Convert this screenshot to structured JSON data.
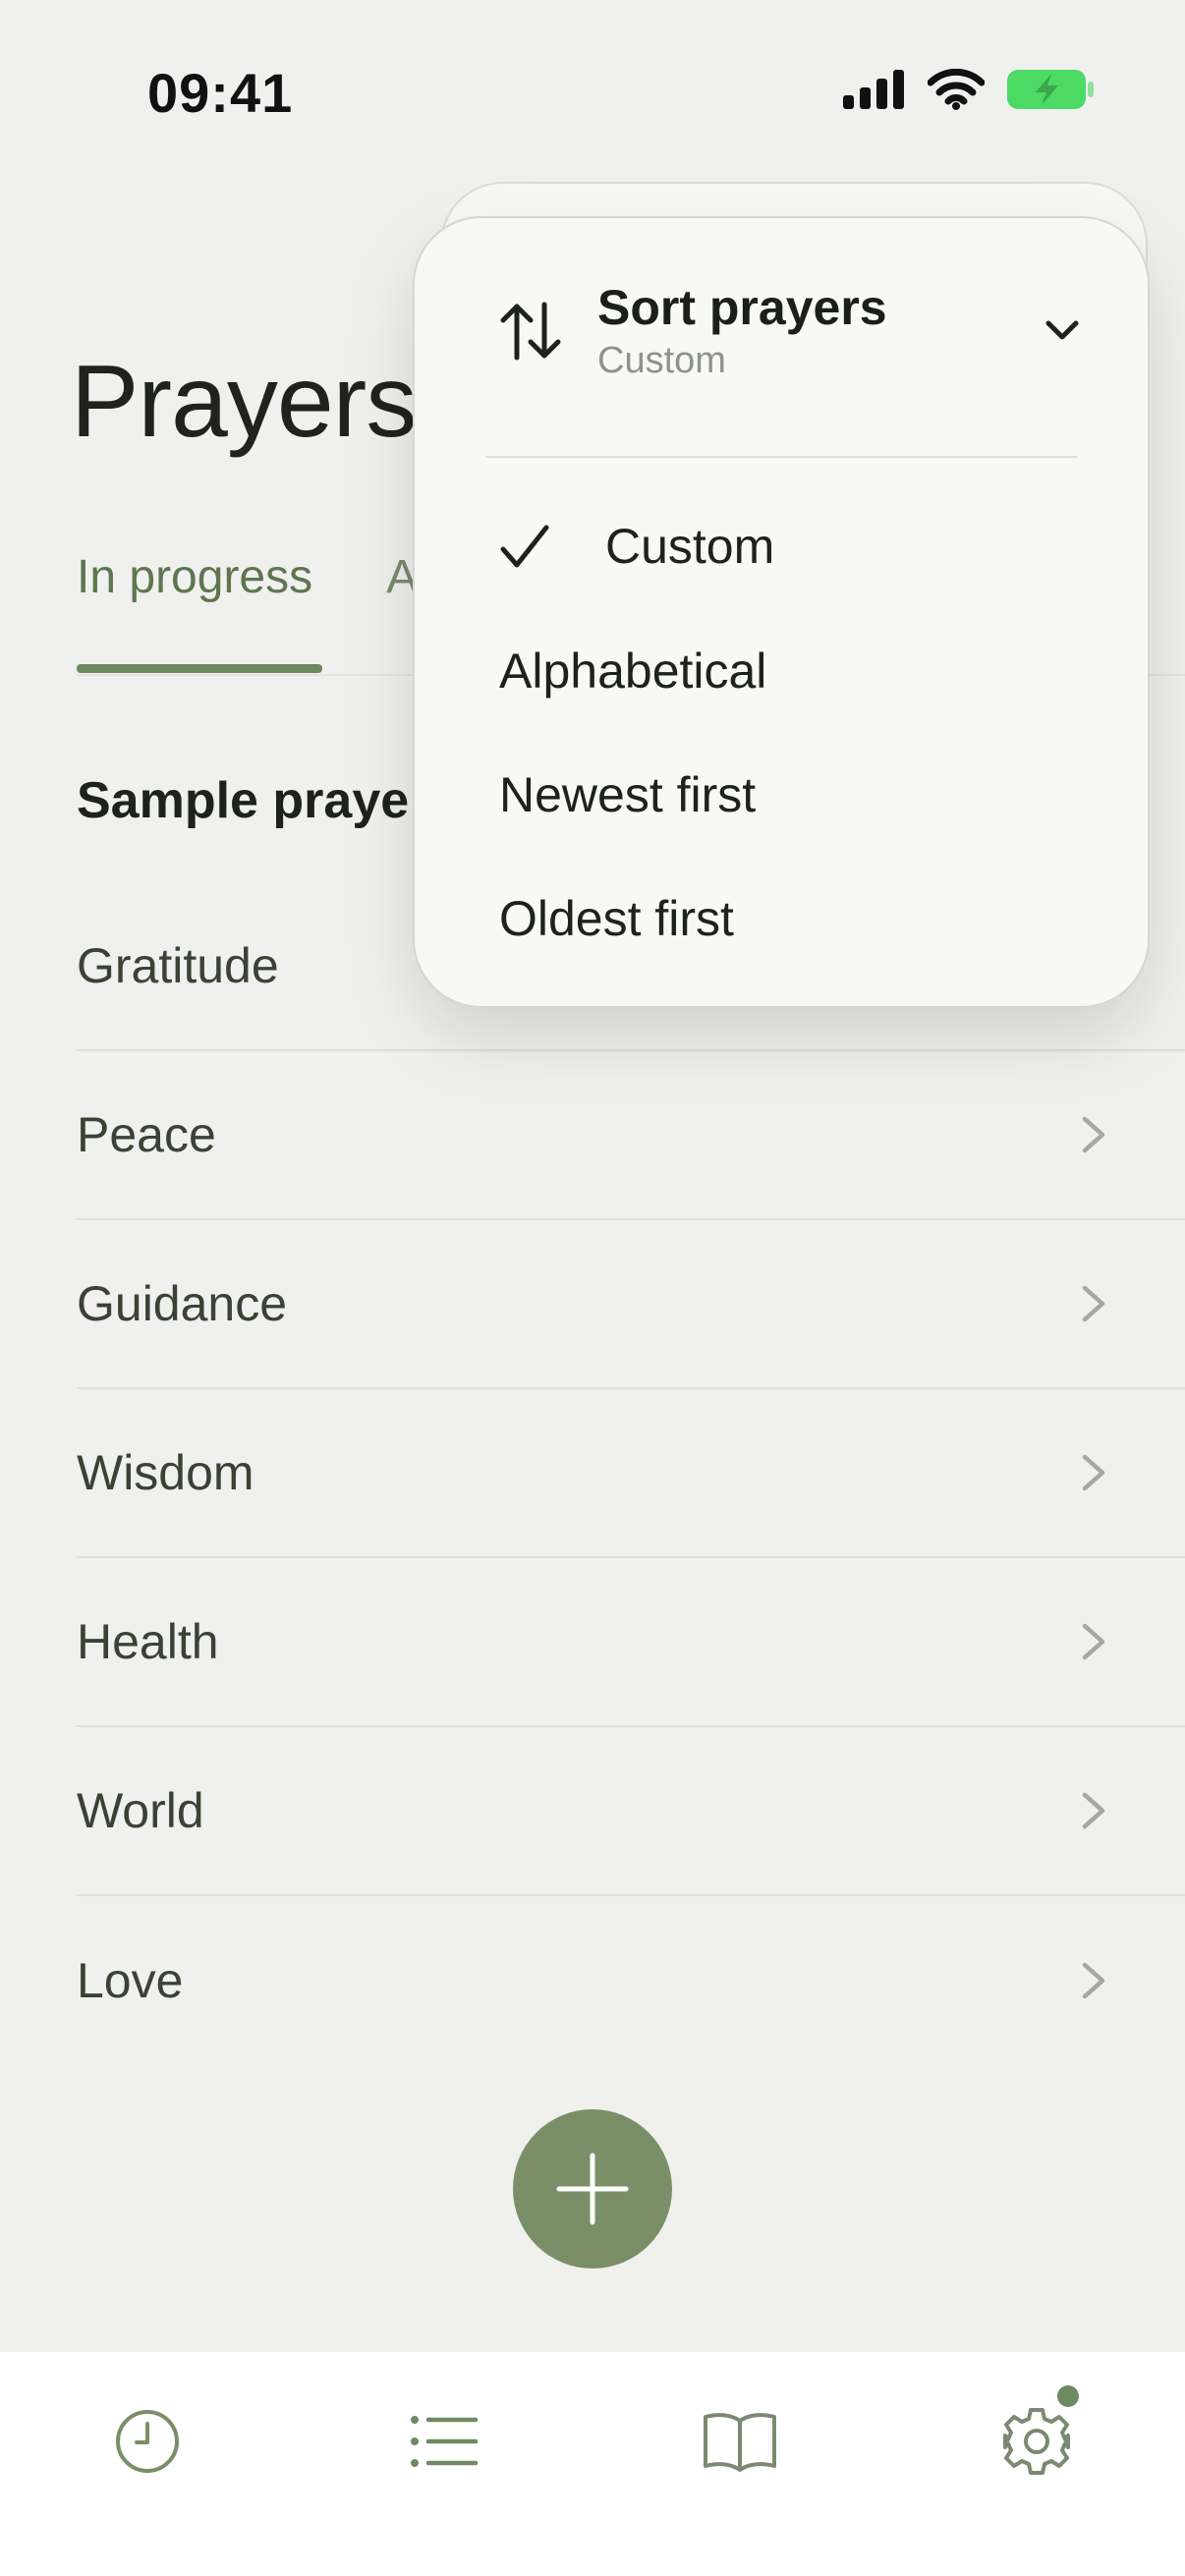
{
  "status_bar": {
    "time": "09:41"
  },
  "header": {
    "title": "Prayers"
  },
  "tabs": [
    {
      "label": "In progress",
      "active": true
    },
    {
      "label": "A",
      "active": false
    }
  ],
  "section": {
    "title": "Sample praye"
  },
  "prayers": [
    {
      "label": "Gratitude"
    },
    {
      "label": "Peace"
    },
    {
      "label": "Guidance"
    },
    {
      "label": "Wisdom"
    },
    {
      "label": "Health"
    },
    {
      "label": "World"
    },
    {
      "label": "Love"
    }
  ],
  "sort_menu": {
    "title": "Sort prayers",
    "current": "Custom",
    "options": [
      {
        "label": "Custom",
        "selected": true
      },
      {
        "label": "Alphabetical",
        "selected": false
      },
      {
        "label": "Newest first",
        "selected": false
      },
      {
        "label": "Oldest first",
        "selected": false
      }
    ]
  },
  "bottom_tabs": [
    {
      "icon": "clock-icon"
    },
    {
      "icon": "list-icon"
    },
    {
      "icon": "book-icon"
    },
    {
      "icon": "gear-icon",
      "has_badge": true
    }
  ],
  "colors": {
    "accent": "#6F8A62",
    "fab": "#7A8F67",
    "background": "#F0F0EE",
    "battery": "#4CD964"
  }
}
